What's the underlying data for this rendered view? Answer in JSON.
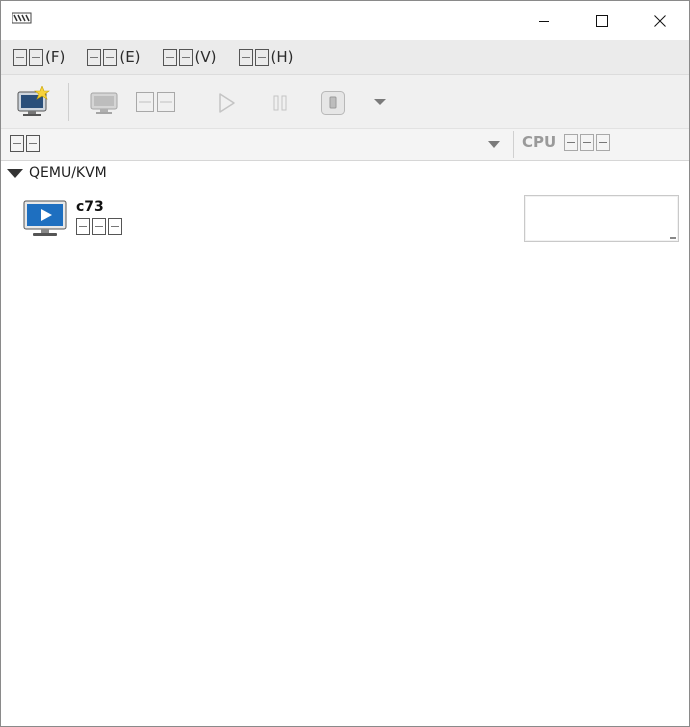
{
  "window": {
    "icon": "virt-manager-icon",
    "controls": {
      "minimize": "minimize-icon",
      "maximize": "maximize-icon",
      "close": "close-icon"
    }
  },
  "menubar": {
    "items": [
      {
        "label": "(F)"
      },
      {
        "label": "(E)"
      },
      {
        "label": "(V)"
      },
      {
        "label": "(H)"
      }
    ]
  },
  "toolbar": {
    "buttons": [
      {
        "icon": "new-vm-icon",
        "enabled": true
      },
      {
        "icon": "open-console-icon",
        "enabled": false
      },
      {
        "icon": "open-label-icon",
        "enabled": false
      },
      {
        "icon": "run-icon",
        "enabled": false
      },
      {
        "icon": "pause-icon",
        "enabled": false
      },
      {
        "icon": "shutdown-icon",
        "enabled": false
      },
      {
        "icon": "dropdown-arrow-icon",
        "enabled": false
      }
    ]
  },
  "header": {
    "cpu_label": "CPU"
  },
  "list": {
    "group": "QEMU/KVM",
    "vms": [
      {
        "name": "c73",
        "icon": "vm-running-icon"
      }
    ]
  },
  "colors": {
    "menubar_bg": "#ebebeb",
    "toolbar_bg": "#f0f0f0",
    "vm_screen_blue": "#1e6fc0"
  }
}
